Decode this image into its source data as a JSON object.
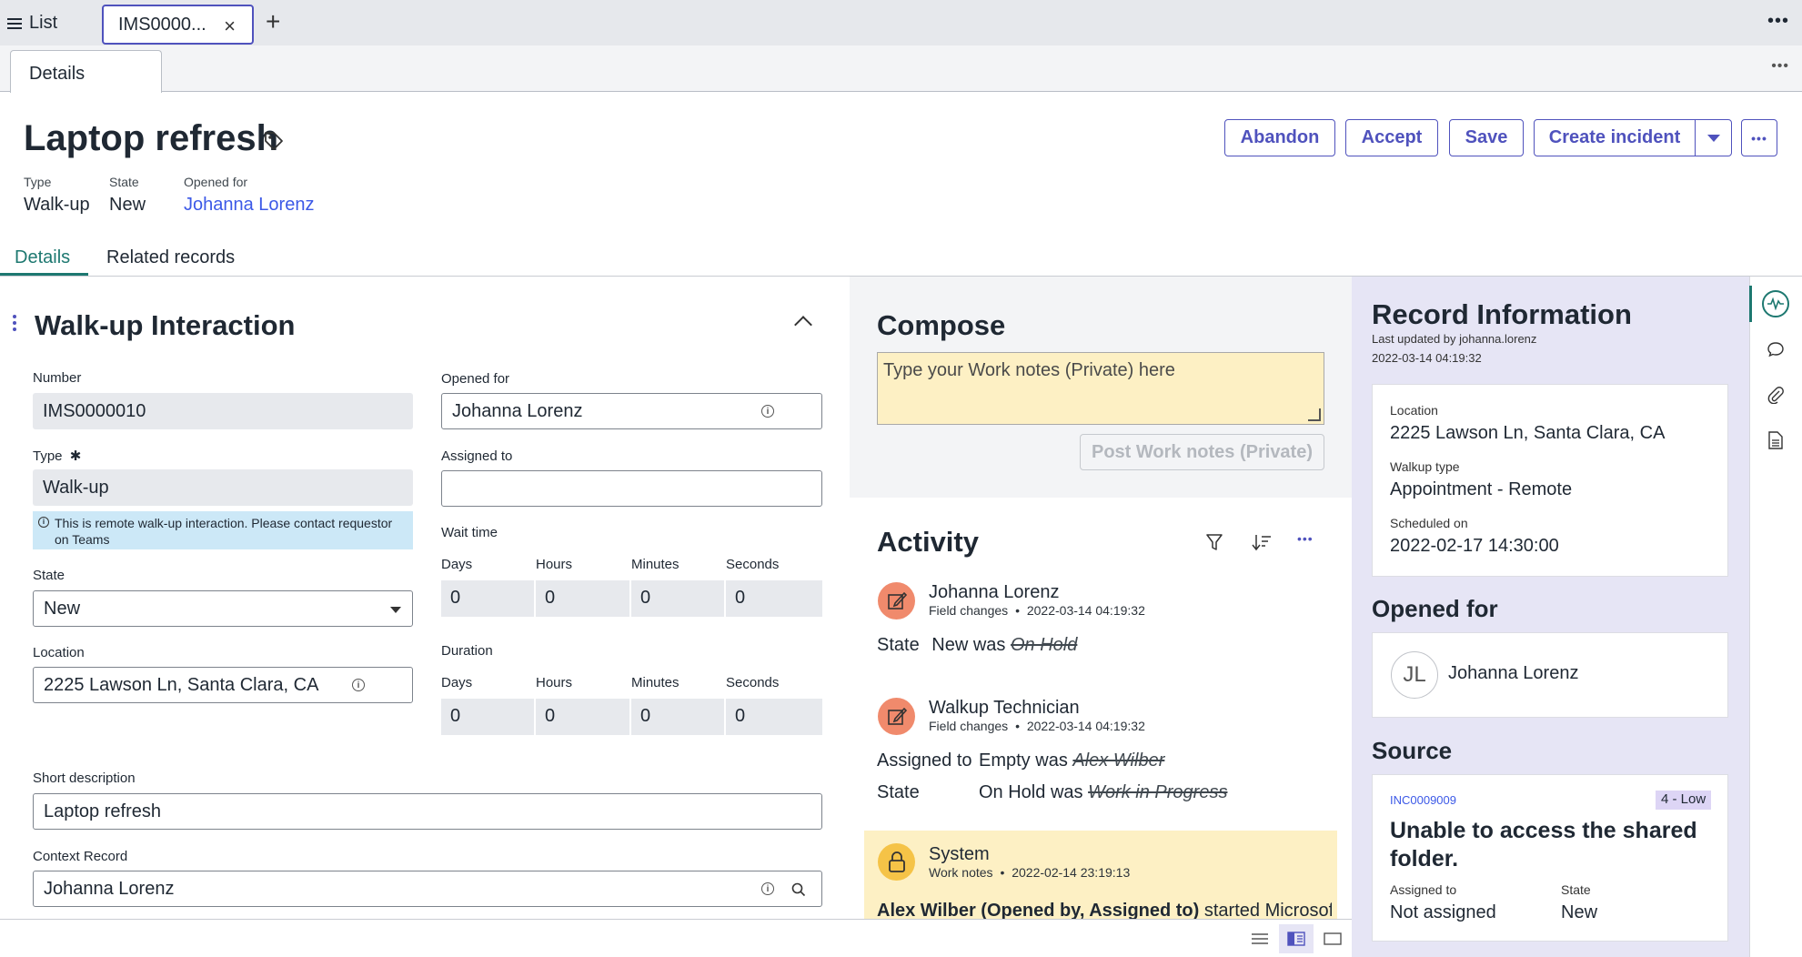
{
  "topbar": {
    "list_label": "List",
    "record_tab_label": "IMS0000...",
    "close_glyph": "×",
    "add_glyph": "+",
    "more_glyph": "•••"
  },
  "subtab": {
    "label": "Details",
    "more_glyph": "•••"
  },
  "header": {
    "title": "Laptop refresh",
    "type_label": "Type",
    "type_value": "Walk-up",
    "state_label": "State",
    "state_value": "New",
    "opened_for_label": "Opened for",
    "opened_for_value": "Johanna Lorenz"
  },
  "actions": {
    "abandon": "Abandon",
    "accept": "Accept",
    "save": "Save",
    "create_incident": "Create incident",
    "more_glyph": "•••"
  },
  "tabs": {
    "details": "Details",
    "related": "Related records"
  },
  "form": {
    "section_title": "Walk-up Interaction",
    "number_label": "Number",
    "number_value": "IMS0000010",
    "type_label": "Type",
    "type_required": "✱",
    "type_value": "Walk-up",
    "hint_text": "This is remote walk-up interaction. Please contact requestor on Teams",
    "state_label": "State",
    "state_value": "New",
    "location_label": "Location",
    "location_value": "2225 Lawson Ln, Santa Clara, CA",
    "opened_for_label": "Opened for",
    "opened_for_value": "Johanna Lorenz",
    "assigned_to_label": "Assigned to",
    "assigned_to_value": "",
    "wait_time_label": "Wait time",
    "duration_label": "Duration",
    "time_units": {
      "days": "Days",
      "hours": "Hours",
      "minutes": "Minutes",
      "seconds": "Seconds"
    },
    "wait_values": {
      "days": "0",
      "hours": "0",
      "minutes": "0",
      "seconds": "0"
    },
    "duration_values": {
      "days": "0",
      "hours": "0",
      "minutes": "0",
      "seconds": "0"
    },
    "short_desc_label": "Short description",
    "short_desc_value": "Laptop refresh",
    "context_label": "Context Record",
    "context_value": "Johanna Lorenz"
  },
  "compose": {
    "title": "Compose",
    "placeholder": "Type your Work notes (Private) here",
    "post_button": "Post Work notes (Private)"
  },
  "activity": {
    "title": "Activity",
    "more_glyph": "•••",
    "entries": [
      {
        "author": "Johanna Lorenz",
        "kind": "Field changes",
        "timestamp": "2022-03-14 04:19:32",
        "changes": [
          {
            "field": "State",
            "new": "New",
            "was_word": "was",
            "old": "On Hold"
          }
        ]
      },
      {
        "author": "Walkup Technician",
        "kind": "Field changes",
        "timestamp": "2022-03-14 04:19:32",
        "changes": [
          {
            "field": "Assigned to",
            "new": "Empty",
            "was_word": "was",
            "old": "Alex Wilber"
          },
          {
            "field": "State",
            "new": "On Hold",
            "was_word": "was",
            "old": "Work in Progress"
          }
        ]
      },
      {
        "author": "System",
        "kind": "Work notes",
        "timestamp": "2022-02-14 23:19:13",
        "body_bold": "Alex Wilber (Opened by, Assigned to)",
        "body_rest": " started Microsoft"
      }
    ],
    "bullet": "•"
  },
  "record_info": {
    "title": "Record Information",
    "last_updated": "Last updated by johanna.lorenz",
    "last_updated_time": "2022-03-14 04:19:32",
    "location_label": "Location",
    "location_value": "2225 Lawson Ln, Santa Clara, CA",
    "walkup_type_label": "Walkup type",
    "walkup_type_value": "Appointment - Remote",
    "scheduled_label": "Scheduled on",
    "scheduled_value": "2022-02-17 14:30:00",
    "opened_for_heading": "Opened for",
    "opened_for_initials": "JL",
    "opened_for_name": "Johanna Lorenz",
    "source_heading": "Source",
    "source_number": "INC0009009",
    "source_priority": "4 - Low",
    "source_title": "Unable to access the shared folder.",
    "source_assigned_label": "Assigned to",
    "source_assigned_value": "Not assigned",
    "source_state_label": "State",
    "source_state_value": "New"
  },
  "colors": {
    "accent": "#4f52bd",
    "link": "#3c59e7",
    "teal": "#1d7870",
    "compose_bg": "#fdf0c4",
    "info_panel_bg": "#e6e5f5"
  }
}
